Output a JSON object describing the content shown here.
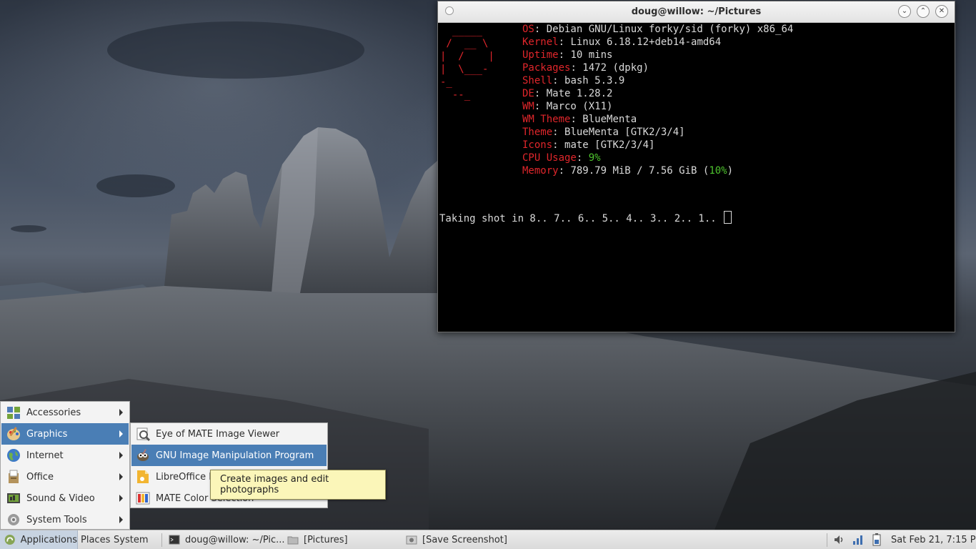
{
  "terminal": {
    "title": "doug@willow: ~/Pictures",
    "logo": "  _____\n /  __ \\\n|  /    |\n|  \\___-\n-_\n  --_",
    "info": [
      {
        "key": "OS",
        "value": "Debian GNU/Linux forky/sid (forky) x86_64"
      },
      {
        "key": "Kernel",
        "value": "Linux 6.18.12+deb14-amd64"
      },
      {
        "key": "Uptime",
        "value": "10 mins"
      },
      {
        "key": "Packages",
        "value": "1472 (dpkg)"
      },
      {
        "key": "Shell",
        "value": "bash 5.3.9"
      },
      {
        "key": "DE",
        "value": "Mate 1.28.2"
      },
      {
        "key": "WM",
        "value": "Marco (X11)"
      },
      {
        "key": "WM Theme",
        "value": "BlueMenta"
      },
      {
        "key": "Theme",
        "value": "BlueMenta [GTK2/3/4]"
      },
      {
        "key": "Icons",
        "value": "mate [GTK2/3/4]"
      },
      {
        "key": "CPU Usage",
        "value": "9%"
      },
      {
        "key": "Memory",
        "value": "789.79 MiB / 7.56 GiB",
        "percent": "10%"
      }
    ],
    "prompt": "Taking shot in 8.. 7.. 6.. 5.. 4.. 3.. 2.. 1.. "
  },
  "menu": {
    "items": [
      {
        "label": "Accessories",
        "icon": "accessories-icon"
      },
      {
        "label": "Graphics",
        "icon": "graphics-icon"
      },
      {
        "label": "Internet",
        "icon": "internet-icon"
      },
      {
        "label": "Office",
        "icon": "office-icon"
      },
      {
        "label": "Sound & Video",
        "icon": "sound-video-icon"
      },
      {
        "label": "System Tools",
        "icon": "system-tools-icon"
      }
    ],
    "submenu": [
      {
        "label": "Eye of MATE Image Viewer",
        "icon": "image-viewer-icon"
      },
      {
        "label": "GNU Image Manipulation Program",
        "icon": "gimp-icon"
      },
      {
        "label": "LibreOffice D",
        "icon": "libreoffice-draw-icon"
      },
      {
        "label": "MATE Color Selection",
        "icon": "color-selection-icon"
      }
    ],
    "tooltip": "Create images and edit photographs"
  },
  "panel": {
    "applications": "Applications",
    "places": "Places",
    "system": "System",
    "tasks": [
      {
        "label": "doug@willow: ~/Pic...",
        "icon": "terminal-icon"
      },
      {
        "label": "[Pictures]",
        "icon": "folder-icon"
      },
      {
        "label": "[Save Screenshot]",
        "icon": "screenshot-icon"
      }
    ],
    "clock": "Sat Feb 21,  7:15 PM"
  },
  "colors": {
    "accent": "#4a7eb5",
    "terminal_key": "#e0262b",
    "terminal_green": "#4ec42e",
    "tooltip_bg": "#fbf6b9"
  }
}
